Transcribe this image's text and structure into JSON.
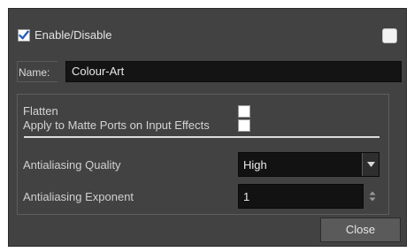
{
  "header": {
    "enable_label": "Enable/Disable",
    "enabled": true
  },
  "name_field": {
    "label": "Name:",
    "value": "Colour-Art"
  },
  "options": {
    "flatten_label": "Flatten",
    "flatten_checked": false,
    "matte_label": "Apply to Matte Ports on Input Effects",
    "matte_checked": false
  },
  "antialiasing": {
    "quality_label": "Antialiasing Quality",
    "quality_value": "High",
    "exponent_label": "Antialiasing Exponent",
    "exponent_value": "1"
  },
  "footer": {
    "close_label": "Close"
  },
  "colors": {
    "dialog_bg": "#424242",
    "field_bg": "#141414",
    "checkmark": "#2a5fb8"
  }
}
